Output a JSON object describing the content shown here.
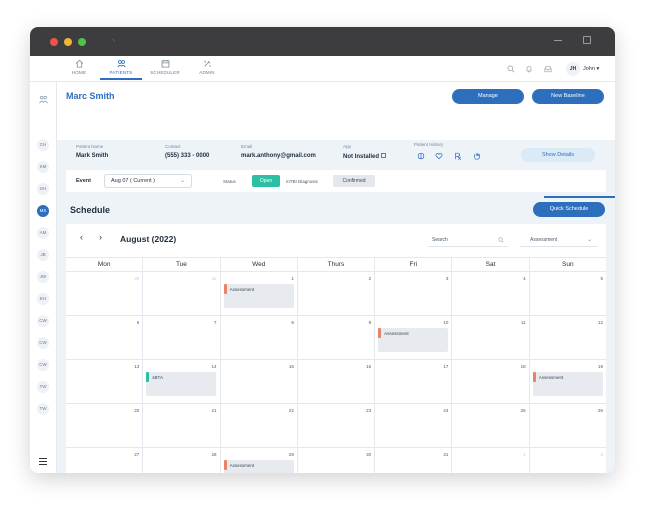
{
  "nav": {
    "items": [
      {
        "label": "HOME",
        "icon": "home-icon"
      },
      {
        "label": "PATIENTS",
        "icon": "patients-icon",
        "active": true
      },
      {
        "label": "SCHEDULER",
        "icon": "calendar-icon"
      },
      {
        "label": "ADMIN",
        "icon": "admin-icon"
      }
    ],
    "user_initials": "JH",
    "user_name": "John",
    "user_chevron": "▾"
  },
  "sidebar": {
    "patients": [
      "CH",
      "KM",
      "GH",
      "MS",
      "AM",
      "JB",
      "JW",
      "EH",
      "CW",
      "CW",
      "CW",
      "TW",
      "TW"
    ],
    "active": "MS"
  },
  "patient": {
    "name": "Marc Smith",
    "manage_label": "Manage",
    "new_baseline_label": "New Baseline",
    "fields": {
      "name_label": "Patient Name",
      "name_value": "Mark Smith",
      "contact_label": "Contact",
      "contact_value": "(555) 333 - 0000",
      "email_label": "Email",
      "email_value": "mark.anthony@gmail.com",
      "app_label": "App",
      "app_value": "Not Installed",
      "history_label": "Patient History"
    },
    "show_details_label": "Show Details"
  },
  "event_row": {
    "event_label": "Event",
    "event_value": "Aug 07 ( Current )",
    "status_label": "Status",
    "status_value": "Open",
    "mtbi_label": "mTBI Diagnosis",
    "mtbi_value": "Confirmed"
  },
  "schedule": {
    "title": "Schedule",
    "quick_schedule_label": "Quick Schedule",
    "month_label": "August (2022)",
    "prev": "‹",
    "next": "›",
    "search_placeholder": "Search",
    "filter_value": "Assessment",
    "days_of_week": [
      "Mon",
      "Tue",
      "Wed",
      "Thurs",
      "Fri",
      "Sat",
      "Sun"
    ],
    "weeks": [
      [
        {
          "num": "30",
          "muted": true
        },
        {
          "num": "31",
          "muted": true
        },
        {
          "num": "1",
          "event": {
            "label": "Assessment",
            "color": "#e8836a"
          }
        },
        {
          "num": "2"
        },
        {
          "num": "3"
        },
        {
          "num": "4"
        },
        {
          "num": "5"
        }
      ],
      [
        {
          "num": "6"
        },
        {
          "num": "7"
        },
        {
          "num": "8"
        },
        {
          "num": "9"
        },
        {
          "num": "10",
          "event": {
            "label": "Assessment",
            "color": "#e8836a"
          }
        },
        {
          "num": "11"
        },
        {
          "num": "12"
        }
      ],
      [
        {
          "num": "13"
        },
        {
          "num": "14",
          "event": {
            "label": "sBTA",
            "color": "#2bbfa4"
          }
        },
        {
          "num": "15"
        },
        {
          "num": "16"
        },
        {
          "num": "17"
        },
        {
          "num": "18"
        },
        {
          "num": "19",
          "event": {
            "label": "Assessment",
            "color": "#e8836a"
          }
        }
      ],
      [
        {
          "num": "20"
        },
        {
          "num": "21"
        },
        {
          "num": "22"
        },
        {
          "num": "23"
        },
        {
          "num": "24"
        },
        {
          "num": "25"
        },
        {
          "num": "26"
        }
      ],
      [
        {
          "num": "27"
        },
        {
          "num": "28"
        },
        {
          "num": "29",
          "event": {
            "label": "Assessment",
            "color": "#e8836a"
          }
        },
        {
          "num": "30"
        },
        {
          "num": "31"
        },
        {
          "num": "1",
          "muted": true
        },
        {
          "num": "2",
          "muted": true
        }
      ]
    ]
  },
  "colors": {
    "primary": "#2d6fbd",
    "open": "#2bbfa4",
    "assessment": "#e8836a",
    "external_link": "#e24b4b"
  }
}
